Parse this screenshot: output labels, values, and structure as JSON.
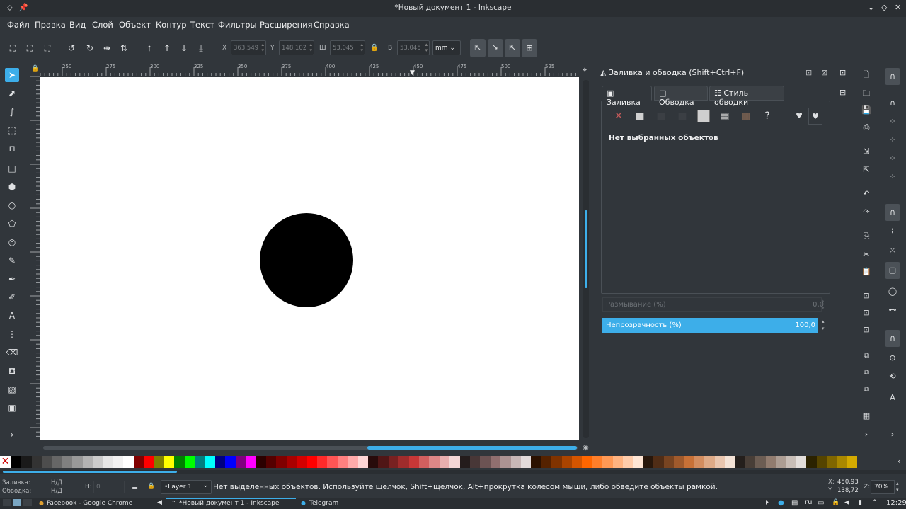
{
  "window": {
    "title": "*Новый документ 1 - Inkscape"
  },
  "menu": [
    "Файл",
    "Правка",
    "Вид",
    "Слой",
    "Объект",
    "Контур",
    "Текст",
    "Фильтры",
    "Расширения",
    "Справка"
  ],
  "toolbar": {
    "x_label": "X",
    "x": "363,549",
    "y_label": "Y",
    "y": "148,102",
    "w_label": "Ш",
    "w": "53,045",
    "h_label": "В",
    "h": "53,045",
    "units": "mm"
  },
  "ruler_top": [
    "250",
    "275",
    "300",
    "325",
    "350",
    "375",
    "400",
    "425",
    "450",
    "475",
    "500",
    "525"
  ],
  "ruler_left": [
    "7",
    "7",
    "5",
    "0",
    "2",
    "5",
    "7",
    "5",
    "1",
    "0",
    "0",
    "1",
    "2",
    "5"
  ],
  "dock": {
    "title": "Заливка и обводка (Shift+Ctrl+F)",
    "tabs": [
      "Заливка",
      "Обводка",
      "Стиль обводки"
    ],
    "no_selection": "Нет выбранных объектов",
    "blur_label": "Размывание (%)",
    "blur_value": "0,0",
    "opacity_label": "Непрозрачность (%)",
    "opacity_value": "100,0",
    "fill_unknown_glyph": "?"
  },
  "status": {
    "fill_label": "Заливка:",
    "fill_value": "Н/Д",
    "stroke_label": "Обводка:",
    "stroke_value": "Н/Д",
    "h_label": "Н:",
    "h_value": "0",
    "layer": "•Layer 1",
    "message": "Нет выделенных объектов. Используйте щелчок, Shift+щелчок, Alt+прокрутка колесом мыши, либо обведите объекты рамкой.",
    "coord_x_label": "X:",
    "coord_x": "450,93",
    "coord_y_label": "Y:",
    "coord_y": "138,72",
    "zoom_label": "Z:",
    "zoom": "70%"
  },
  "taskbar": {
    "tasks": [
      "Facebook - Google Chrome",
      "*Новый документ 1 - Inkscape",
      "Telegram"
    ],
    "lang": "ru",
    "clock": "12:29"
  },
  "accent_color": "#3daee9"
}
